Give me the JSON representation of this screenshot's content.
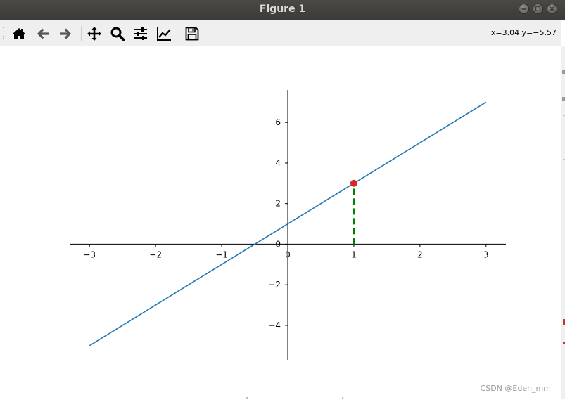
{
  "window": {
    "title": "Figure 1",
    "buttons": [
      "minimize",
      "maximize",
      "close"
    ]
  },
  "toolbar": {
    "buttons": [
      {
        "name": "home",
        "icon": "home-icon"
      },
      {
        "name": "back",
        "icon": "arrow-left-icon"
      },
      {
        "name": "forward",
        "icon": "arrow-right-icon"
      },
      {
        "name": "pan",
        "icon": "move-icon"
      },
      {
        "name": "zoom",
        "icon": "magnifier-icon"
      },
      {
        "name": "configure-subplots",
        "icon": "sliders-icon"
      },
      {
        "name": "edit-axis",
        "icon": "line-chart-icon"
      },
      {
        "name": "save",
        "icon": "floppy-disk-icon"
      }
    ],
    "coordinates": "x=3.04 y=−5.57"
  },
  "watermark": "CSDN @Eden_mm",
  "colors": {
    "line": "#1f77b4",
    "marker": "#d62728",
    "dashed": "#008000",
    "titlebar": "#3c3b37",
    "toolbar": "#efefef"
  },
  "chart_data": {
    "type": "line",
    "spines": "centered",
    "xlim": [
      -3.3,
      3.3
    ],
    "ylim": [
      -5.7,
      7.6
    ],
    "xticks": [
      -3,
      -2,
      -1,
      0,
      1,
      2,
      3
    ],
    "yticks": [
      -4,
      -2,
      0,
      2,
      4,
      6
    ],
    "xtick_labels": [
      "−3",
      "−2",
      "−1",
      "0",
      "1",
      "2",
      "3"
    ],
    "ytick_labels": [
      "−4",
      "−2",
      "0",
      "2",
      "4",
      "6"
    ],
    "series": [
      {
        "x": [
          -3,
          3
        ],
        "y": [
          -5,
          7
        ],
        "color": "#1f77b4"
      }
    ],
    "point": {
      "x": 1,
      "y": 3,
      "color": "#d62728"
    },
    "dashed_line": {
      "x": [
        1,
        1
      ],
      "y": [
        0,
        3
      ],
      "color": "#008000"
    }
  }
}
